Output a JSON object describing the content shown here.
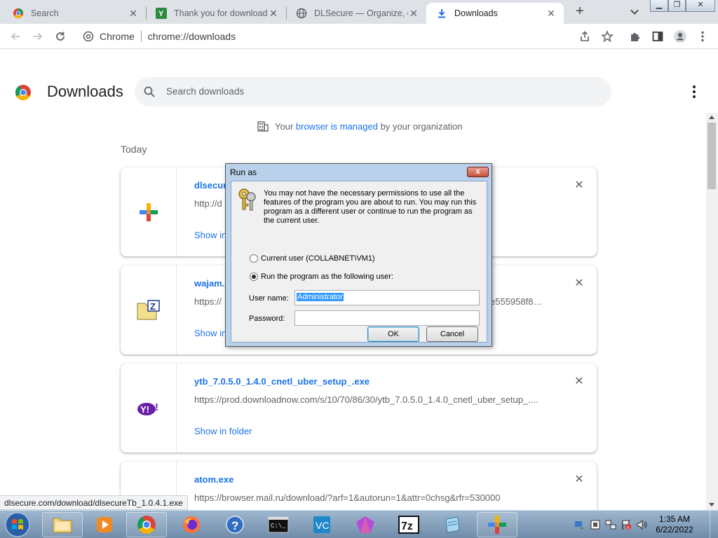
{
  "tabs": [
    {
      "title": "Search",
      "icon": "chrome-icon"
    },
    {
      "title": "Thank you for downloadi",
      "icon": "green-y-icon"
    },
    {
      "title": "DLSecure — Organize, co",
      "icon": "globe-icon"
    },
    {
      "title": "Downloads",
      "icon": "download-icon",
      "active": true
    }
  ],
  "toolbar": {
    "site_label": "Chrome",
    "url": "chrome://downloads"
  },
  "page": {
    "title": "Downloads",
    "search_placeholder": "Search downloads",
    "managed": {
      "prefix": "Your ",
      "link": "browser is managed",
      "suffix": " by your organization"
    },
    "section": "Today",
    "downloads": [
      {
        "name": "dlsecure",
        "url": "http://d",
        "action": "Show in"
      },
      {
        "name": "wajam.z",
        "url": "https://",
        "url_tail": "e555958f8…",
        "action": "Show in"
      },
      {
        "name": "ytb_7.0.5.0_1.4.0_cnetl_uber_setup_.exe",
        "url": "https://prod.downloadnow.com/s/10/70/86/30/ytb_7.0.5.0_1.4.0_cnetl_uber_setup_....",
        "action": "Show in folder"
      },
      {
        "name": "atom.exe",
        "url": "https://browser.mail.ru/download/?arf=1&autorun=1&attr=0chsg&rfr=530000",
        "action": ""
      }
    ]
  },
  "status_url": "dlsecure.com/download/dlsecureTb_1.0.4.1.exe",
  "dialog": {
    "title": "Run as",
    "message": "You may not have the necessary permissions to use all the features of the program you are about to run. You may run this program as a different user or continue to run the program as the current user.",
    "option_current": "Current user (COLLABNET\\VM1)",
    "option_other": "Run the program as the following user:",
    "username_label": "User name:",
    "username_value": "Administrator",
    "password_label": "Password:",
    "password_value": "",
    "ok": "OK",
    "cancel": "Cancel",
    "close": "x"
  },
  "taskbar": {
    "time": "1:35 AM",
    "date": "6/22/2022"
  },
  "colors": {
    "link": "#1a73e8",
    "tabstrip": "#dee1e6",
    "taskbar": "#7d99b5"
  }
}
